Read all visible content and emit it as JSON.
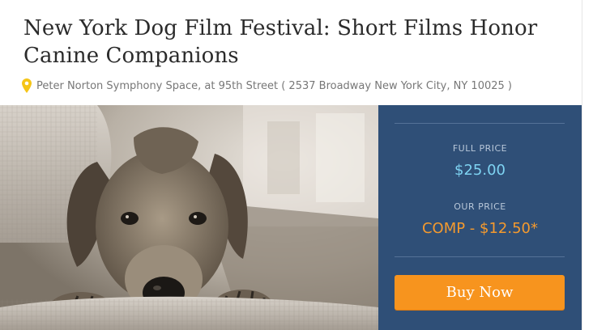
{
  "event": {
    "title": "New York Dog Film Festival: Short Films Honor Canine Companions",
    "address": "Peter Norton Symphony Space, at 95th Street ( 2537 Broadway New York City, NY  10025 )"
  },
  "pricing": {
    "full_price_label": "FULL PRICE",
    "full_price": "$25.00",
    "our_price_label": "OUR PRICE",
    "our_price": "COMP - $12.50*",
    "buy_label": "Buy Now"
  },
  "colors": {
    "panel": "#2f4f77",
    "full_price": "#7ed3f2",
    "our_price": "#f49a2e",
    "button": "#f7941e",
    "pin": "#f5c518"
  },
  "icons": {
    "location": "map-pin-icon"
  }
}
